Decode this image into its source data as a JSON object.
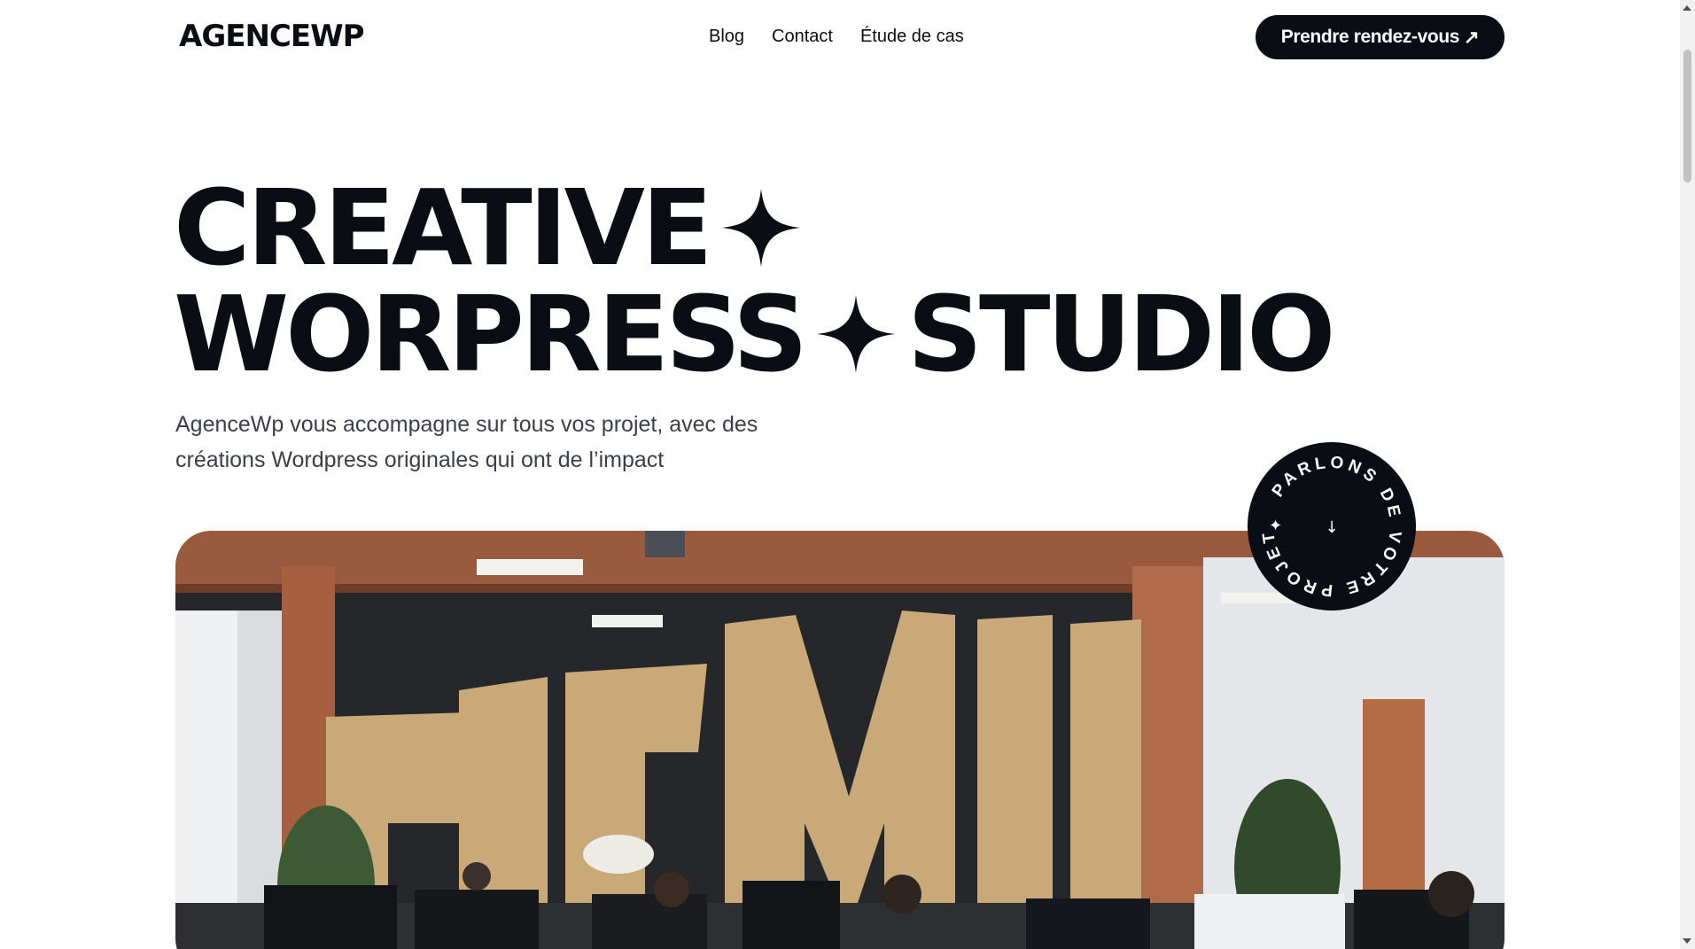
{
  "header": {
    "logo": "AGENCEWP",
    "nav": [
      "Blog",
      "Contact",
      "Étude de cas"
    ],
    "cta_label": "Prendre rendez-vous",
    "cta_icon": "↗"
  },
  "hero": {
    "line1": "CREATIVE",
    "line2a": "WORPRESS",
    "line2b": "STUDIO",
    "subtitle": "AgenceWp vous accompagne sur tous vos projet, avec des créations Wordpress originales qui ont de l’impact"
  },
  "badge": {
    "text": "PARLONS DE VOTRE PROJET",
    "star": "✦",
    "arrow": "↓"
  },
  "colors": {
    "ink": "#0b0d14",
    "body_text": "#3b3f4a",
    "background": "#ffffff"
  }
}
